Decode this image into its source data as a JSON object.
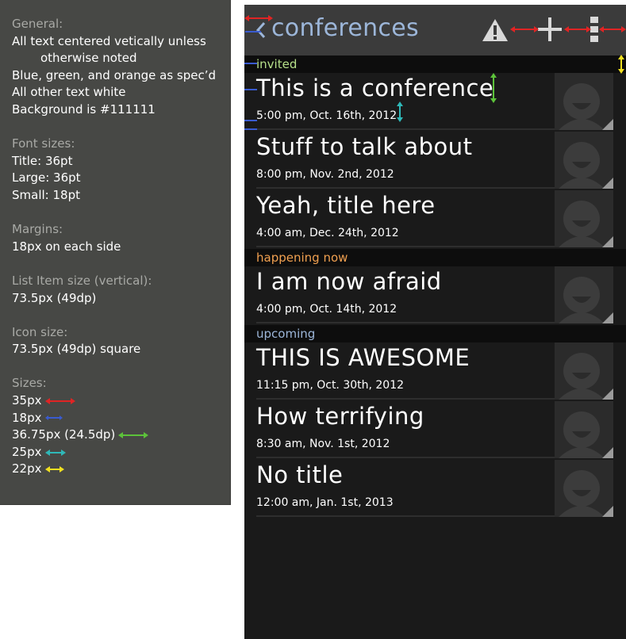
{
  "spec": {
    "general": {
      "title": "General:",
      "lines": [
        "All text centered vetically unless",
        "otherwise noted",
        "Blue, green, and orange as spec’d",
        "All other text white",
        "Background is #111111"
      ]
    },
    "fonts": {
      "title": "Font sizes:",
      "lines": [
        "Title: 36pt",
        "Large: 36pt",
        "Small: 18pt"
      ]
    },
    "margins": {
      "title": "Margins:",
      "lines": [
        "18px on each side"
      ]
    },
    "list_item": {
      "title": "List Item size (vertical):",
      "lines": [
        "73.5px (49dp)"
      ]
    },
    "icon": {
      "title": "Icon size:",
      "lines": [
        "73.5px (49dp) square"
      ]
    },
    "sizes": {
      "title": "Sizes:",
      "rows": [
        {
          "label": "35px",
          "color": "#e02424"
        },
        {
          "label": "18px",
          "color": "#3a5bd0"
        },
        {
          "label": "36.75px (24.5dp)",
          "color": "#5cc23a"
        },
        {
          "label": "25px",
          "color": "#2fb8b8"
        },
        {
          "label": "22px",
          "color": "#f0e020"
        }
      ]
    }
  },
  "app": {
    "title": "conferences",
    "title_color": "#9cb6d9",
    "actions": [
      "warning-icon",
      "add-icon",
      "overflow-menu-icon"
    ]
  },
  "sections": [
    {
      "label": "invited",
      "color": "#b6e08a",
      "items": [
        {
          "title": "This is a conference",
          "time": "5:00 pm, Oct. 16th, 2012"
        },
        {
          "title": "Stuff to talk about",
          "time": "8:00 pm, Nov. 2nd, 2012"
        },
        {
          "title": "Yeah, title here",
          "time": "4:00 am, Dec. 24th, 2012"
        }
      ]
    },
    {
      "label": "happening now",
      "color": "#f0a050",
      "items": [
        {
          "title": "I am now afraid",
          "time": "4:00 pm, Oct. 14th, 2012"
        }
      ]
    },
    {
      "label": "upcoming",
      "color": "#9cb6d9",
      "items": [
        {
          "title": "THIS IS AWESOME",
          "time": "11:15 pm, Oct. 30th, 2012"
        },
        {
          "title": "How terrifying",
          "time": "8:30 am, Nov. 1st, 2012"
        },
        {
          "title": "No title",
          "time": "12:00 am, Jan. 1st, 2013"
        }
      ]
    }
  ]
}
